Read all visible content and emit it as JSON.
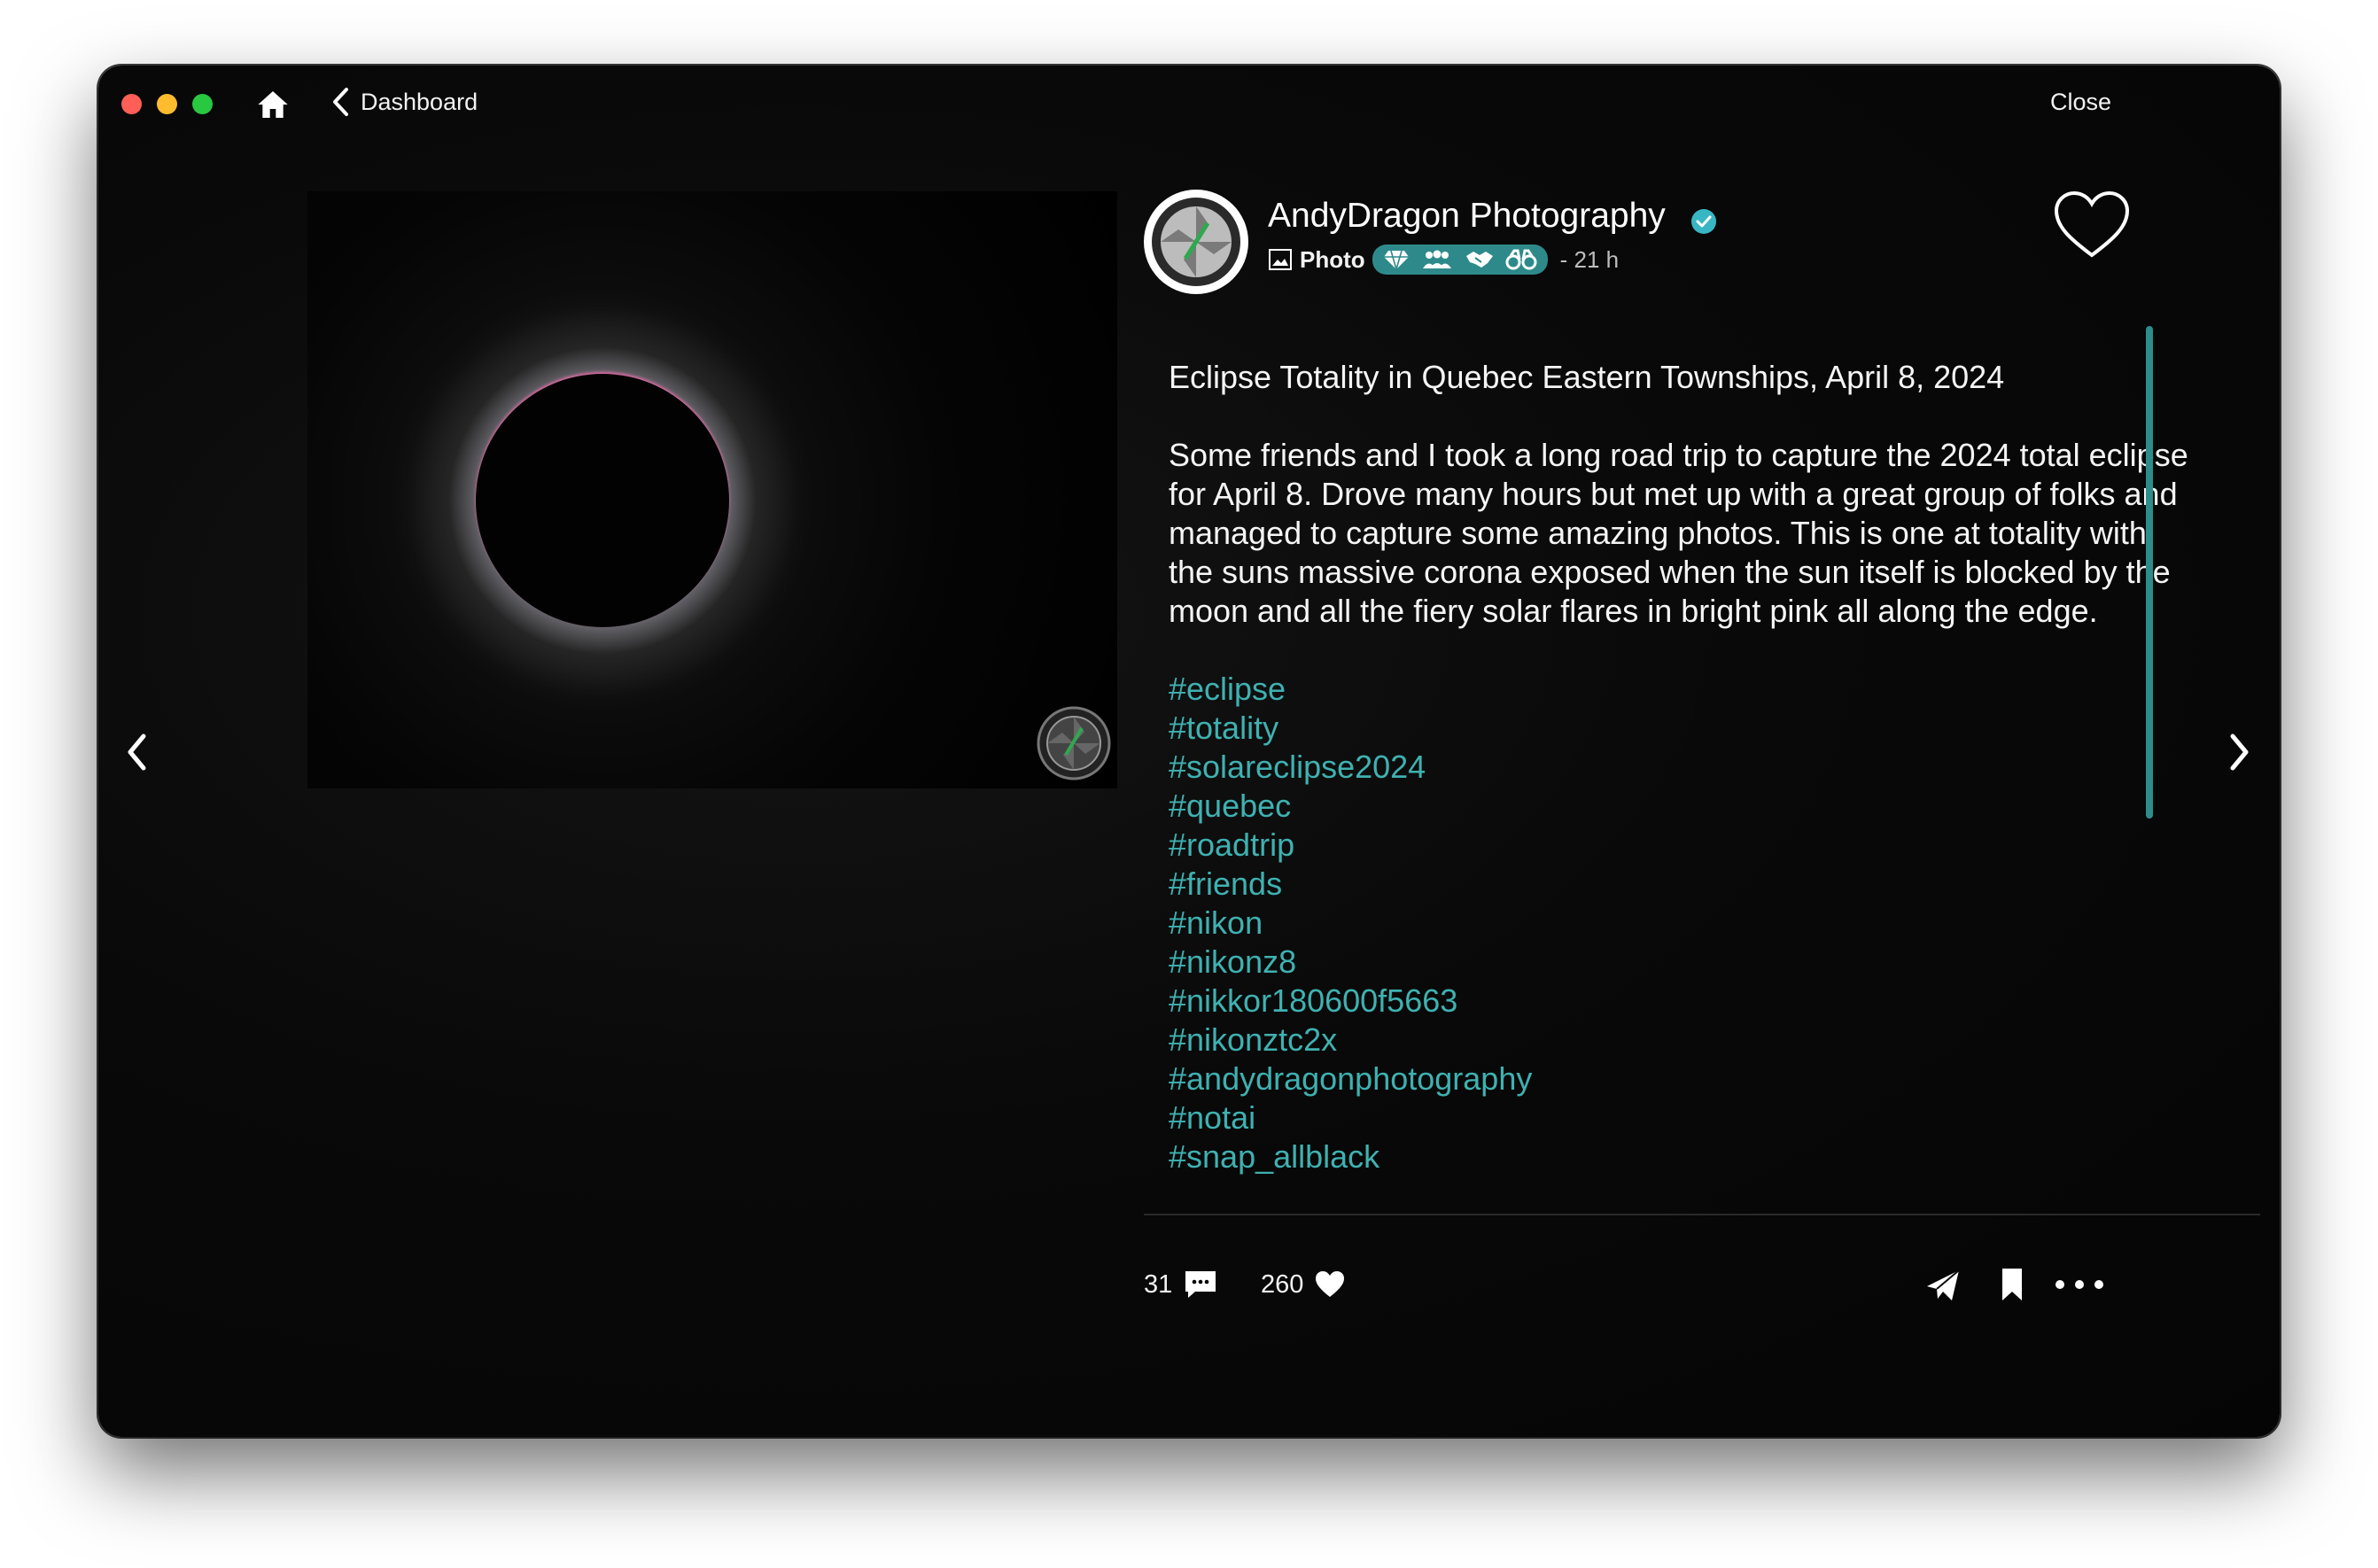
{
  "window": {
    "traffic_lights": [
      "close",
      "minimize",
      "zoom"
    ],
    "nav": {
      "home_icon": "home-icon",
      "back_label": "Dashboard",
      "close_label": "Close"
    }
  },
  "post": {
    "author": "AndyDragon Photography",
    "verified": true,
    "type_label": "Photo",
    "badges": [
      "diamond-icon",
      "group-icon",
      "handshake-icon",
      "binoculars-icon"
    ],
    "time": "- 21 h",
    "title": "Eclipse Totality in Quebec Eastern Townships, April 8, 2024",
    "body": "Some friends and I took a long road trip to capture the 2024 total eclipse for April 8. Drove many hours but met up with a great group of folks and managed to capture some amazing photos.  This is one at totality with the suns massive corona exposed when the sun itself is blocked by the moon and all the fiery solar flares in bright pink all along the edge.",
    "tags": [
      "#eclipse",
      "#totality",
      "#solareclipse2024",
      "#quebec",
      "#roadtrip",
      "#friends",
      "#nikon",
      "#nikonz8",
      "#nikkor180600f5663",
      "#nikonztc2x",
      "#andydragonphotography",
      "#notai",
      "#snap_allblack"
    ],
    "comment_count": "31",
    "like_count": "260"
  },
  "colors": {
    "accent": "#3fb1b1",
    "badge_bg": "#2e8a8a",
    "background": "#050505"
  }
}
